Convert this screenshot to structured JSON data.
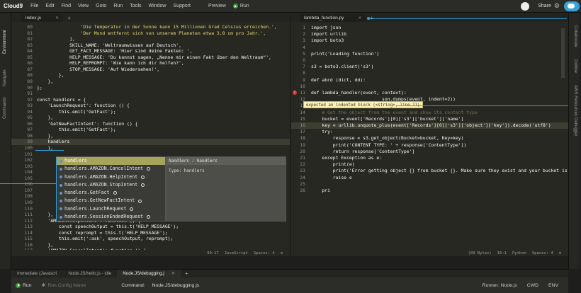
{
  "menubar": {
    "logo": "Cloud9",
    "items": [
      "File",
      "Edit",
      "Find",
      "View",
      "Goto",
      "Run",
      "Tools",
      "Window",
      "Support"
    ],
    "preview": "Preview",
    "run": "Run",
    "share": "Share",
    "gear": "⚙"
  },
  "left_panel": {
    "labels": [
      "Environment",
      "Navigate",
      "Commands"
    ]
  },
  "right_panel": {
    "labels": [
      "Collaborate",
      "Outline",
      "AWS Resources",
      "Debugger"
    ]
  },
  "left_editor": {
    "tab": "index.js",
    "status": {
      "position": "99:17",
      "mode": "JavaScript",
      "spaces": "Spaces: 4"
    },
    "lines": [
      {
        "n": "80",
        "t": "                'Die Temperatur in der Sonne kann 15 Millionen Grad Celsius erreichen.',",
        "c": "str"
      },
      {
        "n": "81",
        "t": "                'Der Mond entfernt sich von unserem Planeten etwa 3,8 cm pro Jahr.',",
        "c": "str"
      },
      {
        "n": "82",
        "t": "            ],",
        "c": ""
      },
      {
        "n": "83",
        "t": "            SKILL_NAME: 'Weltraumwissen auf Deutsch',",
        "c": ""
      },
      {
        "n": "84",
        "t": "            GET_FACT_MESSAGE: 'Hier sind deine Fakten: ',",
        "c": ""
      },
      {
        "n": "85",
        "t": "            HELP_MESSAGE: 'Du kannst sagen, „Nenne mir einen Fakt über den Weltraum“', ",
        "c": ""
      },
      {
        "n": "86",
        "t": "            HELP_REPROMPT: 'Wie kann ich dir helfen?',",
        "c": ""
      },
      {
        "n": "87",
        "t": "            STOP_MESSAGE: 'Auf Wiedersehen!',",
        "c": ""
      },
      {
        "n": "88",
        "t": "        },",
        "c": ""
      },
      {
        "n": "89",
        "t": "    },",
        "c": ""
      },
      {
        "n": "90",
        "t": "};",
        "c": ""
      },
      {
        "n": "91",
        "t": "",
        "c": ""
      },
      {
        "n": "92",
        "t": "const handlers = {",
        "c": ""
      },
      {
        "n": "93",
        "t": "    'LaunchRequest': function () {",
        "c": ""
      },
      {
        "n": "94",
        "t": "        this.emit('GetFact');",
        "c": ""
      },
      {
        "n": "95",
        "t": "    },",
        "c": ""
      },
      {
        "n": "96",
        "t": "    'GetNewFactIntent': function () {",
        "c": ""
      },
      {
        "n": "97",
        "t": "        this.emit('GetFact');",
        "c": ""
      },
      {
        "n": "98",
        "t": "    },",
        "c": ""
      },
      {
        "n": "99",
        "t": "    handlers",
        "c": ""
      },
      {
        "n": "100",
        "t": "    },",
        "c": ""
      },
      {
        "n": "101",
        "t": "",
        "c": ""
      },
      {
        "n": "102",
        "t": "",
        "c": ""
      },
      {
        "n": "103",
        "t": "",
        "c": ""
      },
      {
        "n": "104",
        "t": "",
        "c": ""
      },
      {
        "n": "105",
        "t": "",
        "c": ""
      },
      {
        "n": "106",
        "t": "",
        "c": ""
      },
      {
        "n": "107",
        "t": "",
        "c": ""
      },
      {
        "n": "108",
        "t": "",
        "c": ""
      },
      {
        "n": "109",
        "t": "",
        "c": ""
      },
      {
        "n": "110",
        "t": "        this.emit(':tellWithCard', speechOutput, this.t('SKILL_NAME'), randomFact);",
        "c": ""
      },
      {
        "n": "111",
        "t": "    },",
        "c": ""
      },
      {
        "n": "112",
        "t": "    'AMAZON.HelpIntent': function () {",
        "c": ""
      },
      {
        "n": "113",
        "t": "        const speechOutput = this.t('HELP_MESSAGE');",
        "c": ""
      },
      {
        "n": "114",
        "t": "        const reprompt = this.t('HELP_MESSAGE');",
        "c": ""
      },
      {
        "n": "115",
        "t": "        this.emit(':ask', speechOutput, reprompt);",
        "c": ""
      },
      {
        "n": "116",
        "t": "    },",
        "c": ""
      },
      {
        "n": "117",
        "t": "    'AMAZON.CancelIntent': function () {",
        "c": ""
      }
    ]
  },
  "autocomplete": {
    "items": [
      "handlers",
      "handlers.AMAZON.CancelIntent",
      "handlers.AMAZON.HelpIntent",
      "handlers.AMAZON.StopIntent",
      "handlers.GetFact",
      "handlers.GetNewFactIntent",
      "handlers.LaunchRequest",
      "handlers.SessionEndedRequest"
    ],
    "doc_title": "handlers : handlers",
    "doc_body": "Type: handlers"
  },
  "right_editor": {
    "tab": "lambda_function.py",
    "status": {
      "size": "(89 Bytes)",
      "position": "16:1",
      "mode": "Python",
      "spaces": "Spaces: 4"
    },
    "error_tip": "expected an indented block (<string>, line 11)",
    "lines": [
      {
        "n": "1",
        "t": "import json"
      },
      {
        "n": "2",
        "t": "import urllib"
      },
      {
        "n": "3",
        "t": "import boto3"
      },
      {
        "n": "4",
        "t": ""
      },
      {
        "n": "5",
        "t": "print('Loading function')"
      },
      {
        "n": "6",
        "t": ""
      },
      {
        "n": "7",
        "t": "s3 = boto3.client('s3')"
      },
      {
        "n": "8",
        "t": ""
      },
      {
        "n": "9",
        "t": "def abcd (dict, dd):"
      },
      {
        "n": "10",
        "t": ""
      },
      {
        "n": "11",
        "t": "def lambda_handler(event, context):"
      },
      {
        "n": "12",
        "t": "                          son.dumps(event, indent=2))"
      },
      {
        "n": "13",
        "t": ""
      },
      {
        "n": "14",
        "t": "    # Get the object from the event and show its content type"
      },
      {
        "n": "15",
        "t": "    bucket = event['Records'][0]['s3']['bucket']['name']"
      },
      {
        "n": "16",
        "t": "    key = urllib.unquote_plus(event['Records'][0]['s3']['object']['key']).decode('utf8')"
      },
      {
        "n": "17",
        "t": "    try:"
      },
      {
        "n": "18",
        "t": "        response = s3.get_object(Bucket=bucket, Key=key)"
      },
      {
        "n": "19",
        "t": "        print('CONTENT TYPE: ' + response['ContentType'])"
      },
      {
        "n": "20",
        "t": "        return response['ContentType']"
      },
      {
        "n": "21",
        "t": "    except Exception as e:"
      },
      {
        "n": "22",
        "t": "        print(e)"
      },
      {
        "n": "23",
        "t": "        print('Error getting object {} from bucket {}. Make sure they exist and your bucket is in the same region as this function.'.format(key, bucket))"
      },
      {
        "n": "24",
        "t": "        raise e"
      },
      {
        "n": "25",
        "t": ""
      },
      {
        "n": "26",
        "t": "    pri"
      }
    ]
  },
  "terminal": {
    "tabs": [
      "Immediate (Javascri",
      "Node.JS/hello.js - idle",
      "Node.JS/debugging.j"
    ],
    "plus": "+",
    "run": "Run",
    "run_config": "Run Config Name",
    "command_label": "Command:",
    "command_value": "Node.JS/debugging.js",
    "runner": "Runner: Node.js",
    "cwd": "CWD",
    "env": "ENV"
  },
  "colors": {
    "accent": "#2d9fd9",
    "editor_bg": "#272822",
    "selected": "#a6a35a"
  }
}
